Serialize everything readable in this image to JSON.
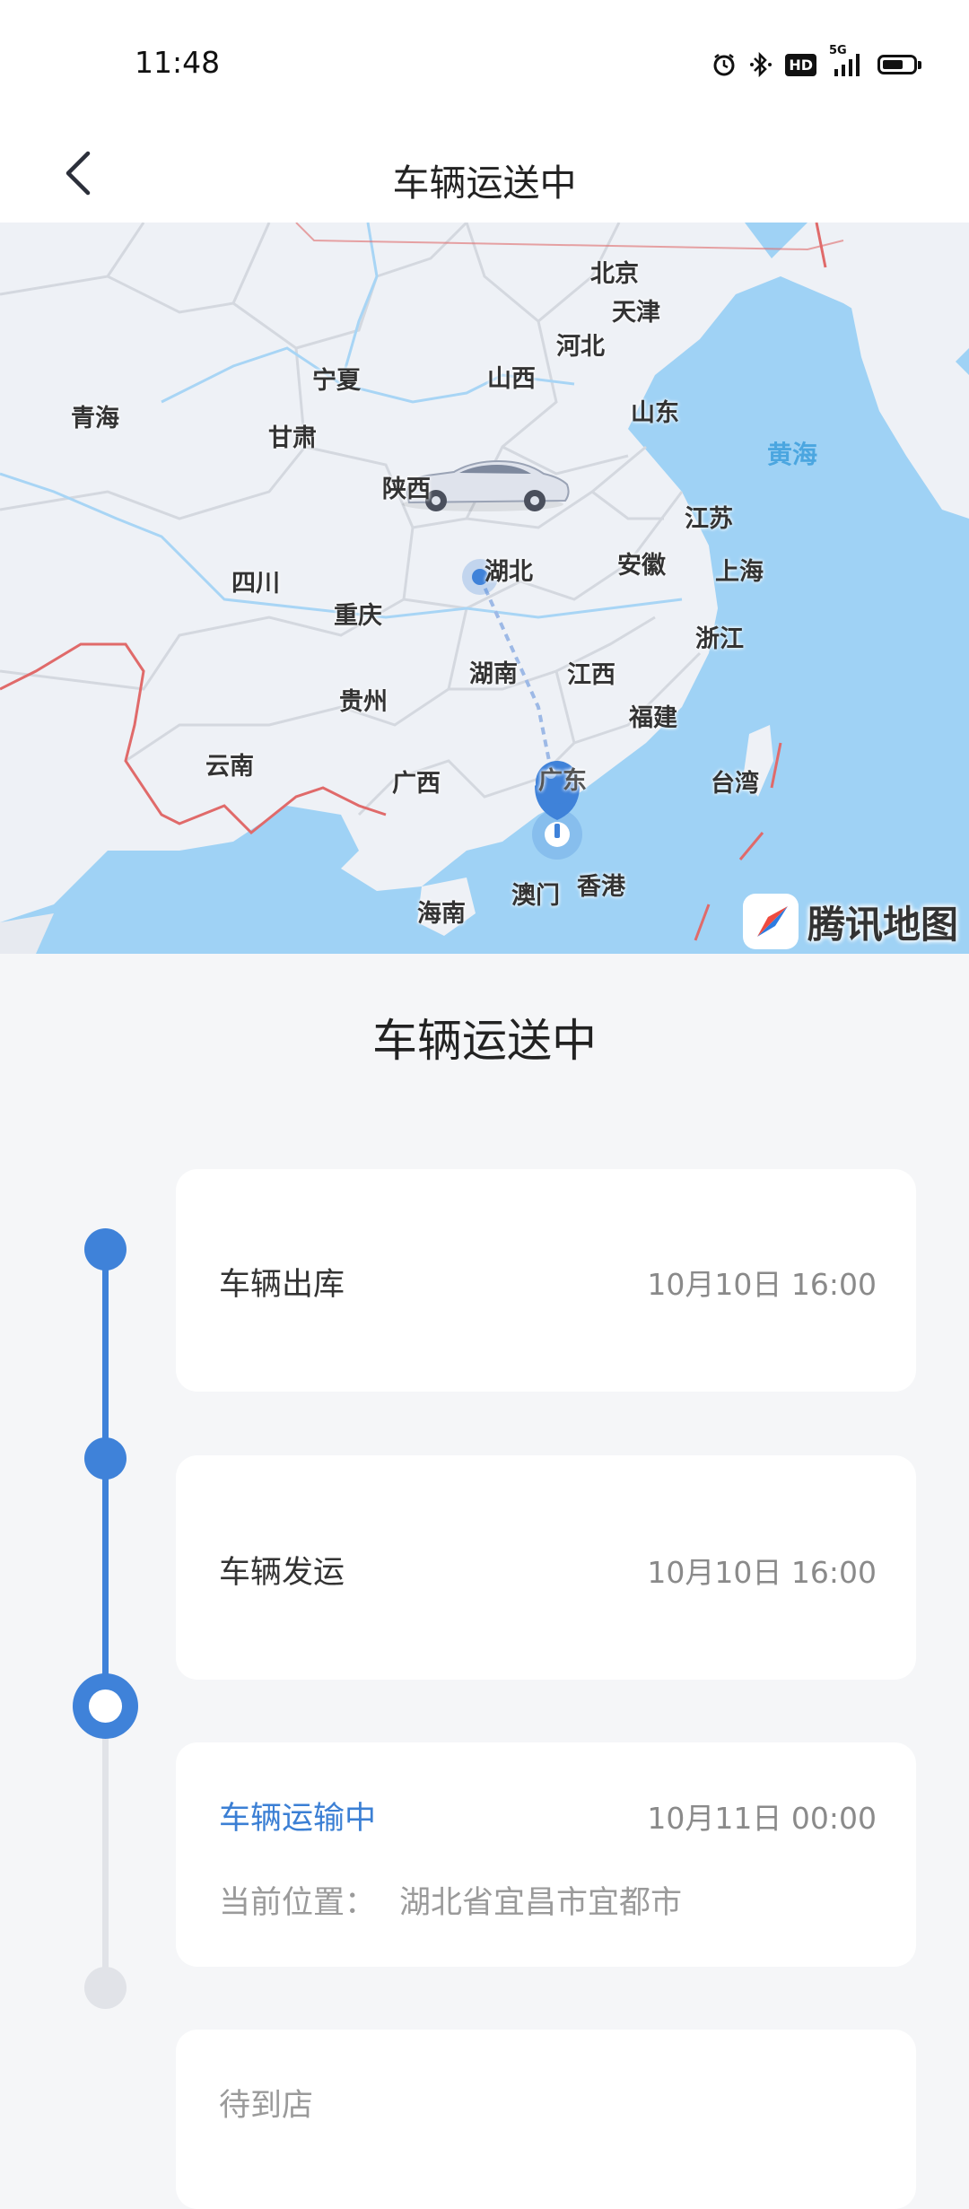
{
  "status_bar": {
    "time": "11:48",
    "network": "5G",
    "hd": "HD",
    "icons": [
      "alarm-icon",
      "bluetooth-icon",
      "hd-icon",
      "signal-icon",
      "battery-icon"
    ],
    "battery_level": 0.7
  },
  "nav": {
    "title": "车辆运送中",
    "back_icon": "chevron-left-icon"
  },
  "map": {
    "provider": "腾讯地图",
    "labels": [
      "北京",
      "天津",
      "河北",
      "山西",
      "宁夏",
      "山东",
      "青海",
      "甘肃",
      "陕西",
      "黄海",
      "江苏",
      "安徽",
      "上海",
      "湖北",
      "四川",
      "重庆",
      "浙江",
      "湖南",
      "江西",
      "福建",
      "贵州",
      "云南",
      "广西",
      "广东",
      "台湾",
      "澳门",
      "香港",
      "海南"
    ],
    "colors": {
      "land": "#eef1f6",
      "water": "#9fd2f5",
      "border": "#ffffff",
      "national_border": "#e06a6a",
      "marker": "#3f82d9"
    }
  },
  "section_title": "车辆运送中",
  "timeline": {
    "colors": {
      "active": "#3f82d9",
      "inactive": "#e1e3e8"
    },
    "steps": [
      {
        "label": "车辆出库",
        "time": "10月10日 16:00",
        "state": "done"
      },
      {
        "label": "车辆发运",
        "time": "10月10日 16:00",
        "state": "done"
      },
      {
        "label": "车辆运输中",
        "time": "10月11日 00:00",
        "state": "current",
        "location_label": "当前位置：",
        "location": "湖北省宜昌市宜都市"
      },
      {
        "label": "待到店",
        "state": "pending"
      }
    ]
  }
}
